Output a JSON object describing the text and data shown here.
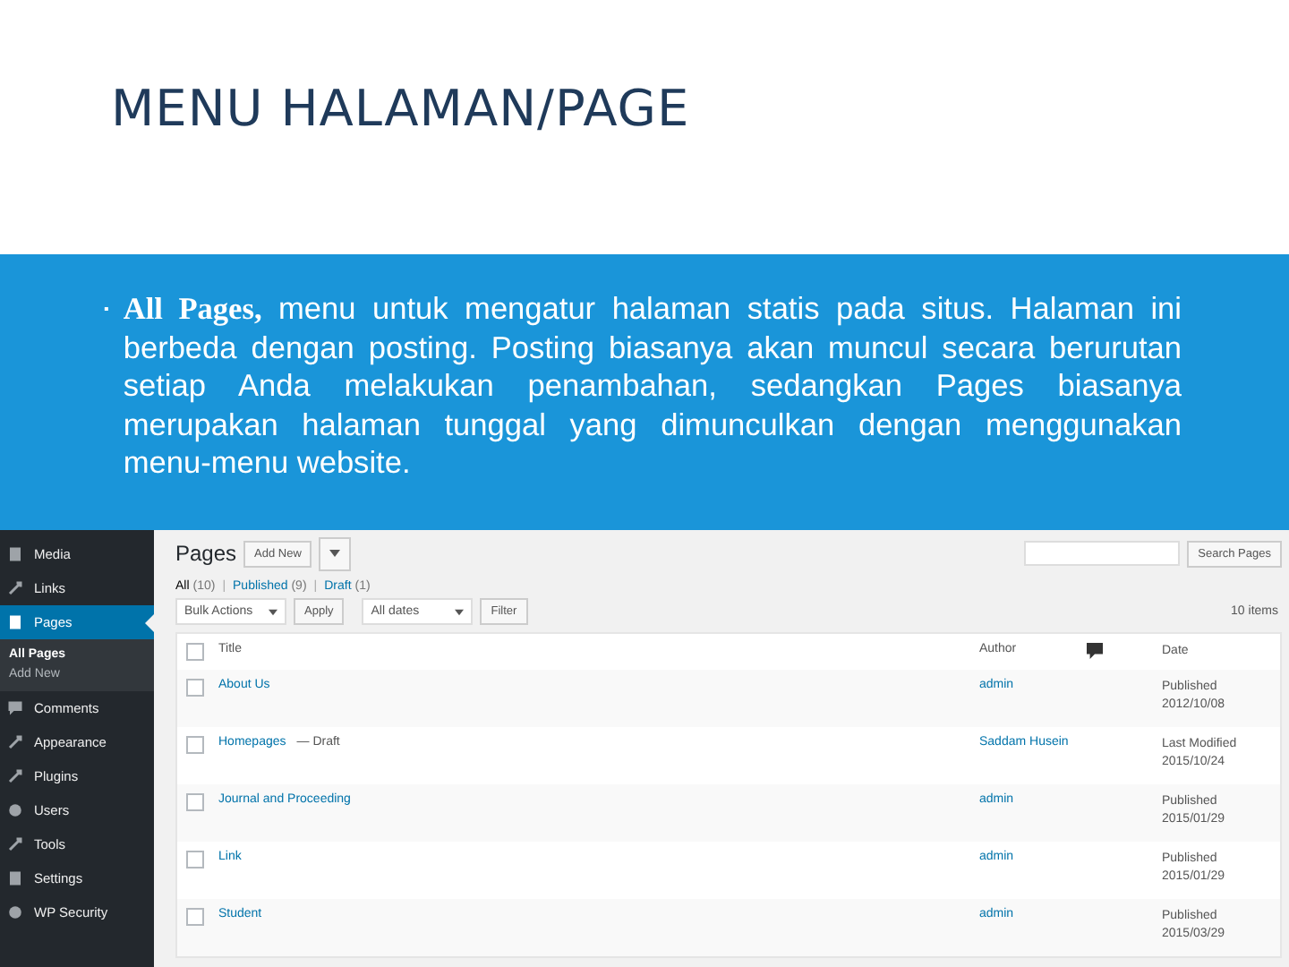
{
  "slide": {
    "title": "MENU HALAMAN/PAGE",
    "bullet": "▪",
    "text": "**All Pages,** menu untuk mengatur halaman statis pada situs. Halaman ini berbeda dengan posting. Posting biasanya akan muncul secara berurutan setiap Anda melakukan penambahan, sedangkan Pages biasanya merupakan halaman tunggal yang dimunculkan dengan menggunakan menu-menu website."
  },
  "sidebar": {
    "items": [
      {
        "label": "Media",
        "selected": false
      },
      {
        "label": "Links",
        "selected": false
      },
      {
        "label": "Pages",
        "selected": true,
        "children": [
          {
            "label": "All Pages",
            "selected": true
          },
          {
            "label": "Add New",
            "selected": false
          }
        ]
      },
      {
        "label": "Comments",
        "selected": false
      },
      {
        "label": "Appearance",
        "selected": false
      },
      {
        "label": "Plugins",
        "selected": false
      },
      {
        "label": "Users",
        "selected": false
      },
      {
        "label": "Tools",
        "selected": false
      },
      {
        "label": "Settings",
        "selected": false
      },
      {
        "label": "WP Security",
        "selected": false
      }
    ]
  },
  "content": {
    "heading": "Pages",
    "add_new": "Add New",
    "filters": [
      {
        "label": "All",
        "count": "(10)",
        "selected": true
      },
      {
        "label": "Published",
        "count": "(9)",
        "selected": false
      },
      {
        "label": "Draft",
        "count": "(1)",
        "selected": false
      }
    ],
    "filter_separator": "|",
    "select_all_checked": false,
    "bulk_actions": "Bulk Actions",
    "apply": "Apply",
    "dates": "All dates",
    "filter": "Filter",
    "search_button": "Search Pages",
    "item_count": "10 items",
    "columns": [
      "Title",
      "Author",
      "Date"
    ],
    "rows": [
      {
        "checked": false,
        "title": "About Us",
        "author": "admin",
        "status": "Published",
        "date": "2012/10/08"
      },
      {
        "checked": false,
        "title": "Homepages",
        "state": "— Draft",
        "author": "Saddam Husein",
        "status": "Last Modified",
        "date": "2015/10/24"
      },
      {
        "checked": false,
        "title": "Journal and Proceeding",
        "author": "admin",
        "status": "Published",
        "date": "2015/01/29"
      },
      {
        "checked": false,
        "title": "Link",
        "author": "admin",
        "status": "Published",
        "date": "2015/01/29"
      },
      {
        "checked": false,
        "title": "Student",
        "author": "admin",
        "status": "Published",
        "date": "2015/03/29"
      }
    ]
  }
}
